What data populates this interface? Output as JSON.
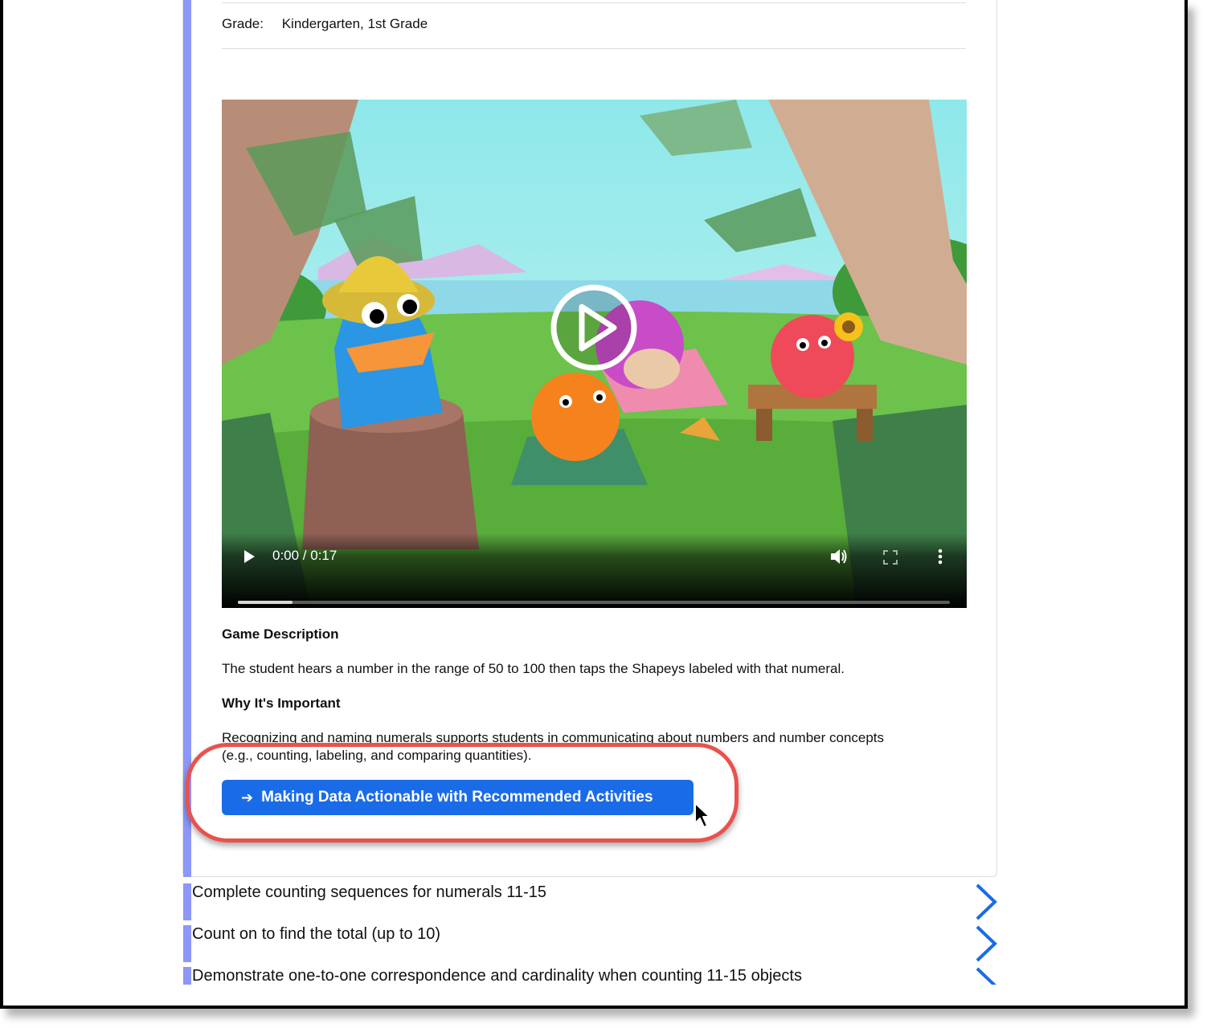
{
  "details": {
    "grade_label": "Grade:",
    "grade_value": "Kindergarten, 1st Grade"
  },
  "video": {
    "time": "0:00 / 0:17",
    "progress_fraction": 0.077,
    "play_icon": "play-icon",
    "volume_icon": "volume-icon",
    "fullscreen_icon": "fullscreen-icon",
    "more_icon": "more-vertical-icon"
  },
  "description": {
    "heading": "Game Description",
    "text": "The student hears a number in the range of 50 to 100 then taps the Shapeys labeled with that numeral.",
    "why_heading": "Why It's Important",
    "why_line1": "Recognizing and naming numerals supports students in communicating about numbers and number concepts",
    "why_line2": "(e.g., counting, labeling, and comparing quantities)."
  },
  "cta": {
    "label": "Making Data Actionable with Recommended Activities",
    "icon": "arrow-right-icon"
  },
  "list": [
    {
      "label": "Complete counting sequences for numerals 11-15"
    },
    {
      "label": "Count on to find the total (up to 10)"
    },
    {
      "label": "Demonstrate one-to-one correspondence and cardinality when counting 11-15 objects"
    }
  ],
  "colors": {
    "accent": "#1a6be8",
    "bar": "#8d97f8",
    "highlight": "#e9524d",
    "chevron": "#1a6be8"
  }
}
